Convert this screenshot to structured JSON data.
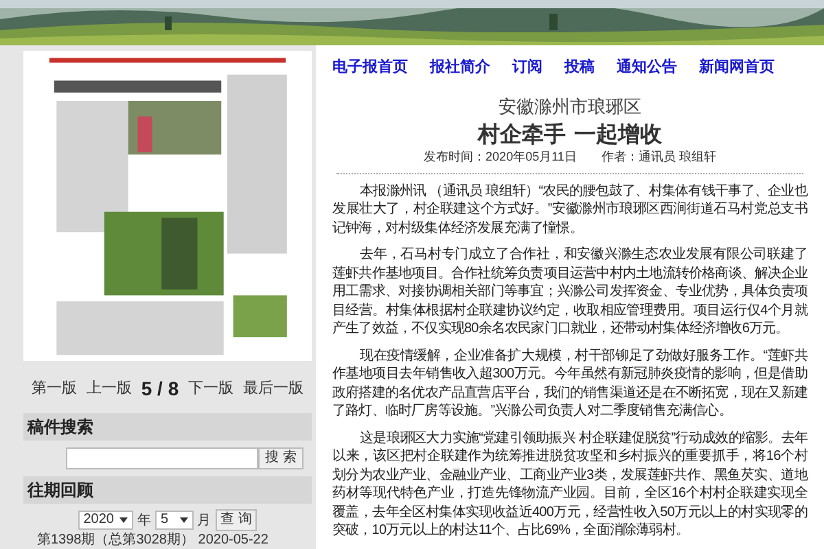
{
  "pager": [
    {
      "label": "第一版",
      "kind": "link"
    },
    {
      "label": "上一版",
      "kind": "link"
    },
    {
      "label": "5 / 8",
      "kind": "current"
    },
    {
      "label": "下一版",
      "kind": "link"
    },
    {
      "label": "最后一版",
      "kind": "link"
    }
  ],
  "search": {
    "title": "稿件搜索",
    "button": "搜 索"
  },
  "archive": {
    "title": "往期回顾",
    "year": "2020",
    "year_unit": "年",
    "month": "5",
    "month_unit": "月",
    "button": "查 询",
    "issues": [
      "第1398期（总第3028期） 2020-05-22"
    ]
  },
  "nav": [
    "电子报首页",
    "报社简介",
    "订阅",
    "投稿",
    "通知公告",
    "新闻网首页"
  ],
  "article": {
    "kicker": "安徽滁州市琅琊区",
    "title": "村企牵手 一起增收",
    "meta": "发布时间：2020年05月11日　　作者：通讯员 琅组轩",
    "paragraphs": [
      "本报滁州讯 （通讯员 琅组轩）“农民的腰包鼓了、村集体有钱干事了、企业也发展壮大了，村企联建这个方式好。”安徽滁州市琅琊区西涧街道石马村党总支书记钟海，对村级集体经济发展充满了憧憬。",
      "去年，石马村专门成立了合作社，和安徽兴滁生态农业发展有限公司联建了莲虾共作基地项目。合作社统筹负责项目运营中村内土地流转价格商谈、解决企业用工需求、对接协调相关部门等事宜；兴滁公司发挥资金、专业优势，具体负责项目经营。村集体根据村企联建协议约定，收取相应管理费用。项目运行仅4个月就产生了效益，不仅实现80余名农民家门口就业，还带动村集体经济增收6万元。",
      "现在疫情缓解，企业准备扩大规模，村干部铆足了劲做好服务工作。“莲虾共作基地项目去年销售收入超300万元。今年虽然有新冠肺炎疫情的影响，但是借助政府搭建的名优农产品直营店平台，我们的销售渠道还是在不断拓宽，现在又新建了路灯、临时厂房等设施。”兴滁公司负责人对二季度销售充满信心。",
      "这是琅琊区大力实施“党建引领助振兴 村企联建促脱贫”行动成效的缩影。去年以来，该区把村企联建作为统筹推进脱贫攻坚和乡村振兴的重要抓手，将16个村划分为农业产业、金融业产业、工商业产业3类，发展莲虾共作、黑鱼芡实、道地药材等现代特色产业，打造先锋物流产业园。目前，全区16个村村企联建实现全覆盖，去年全区村集体实现收益近400万元，经营性收入50万元以上的村实现零的突破，10万元以上的村达11个、占比69%，全面消除薄弱村。"
    ]
  }
}
